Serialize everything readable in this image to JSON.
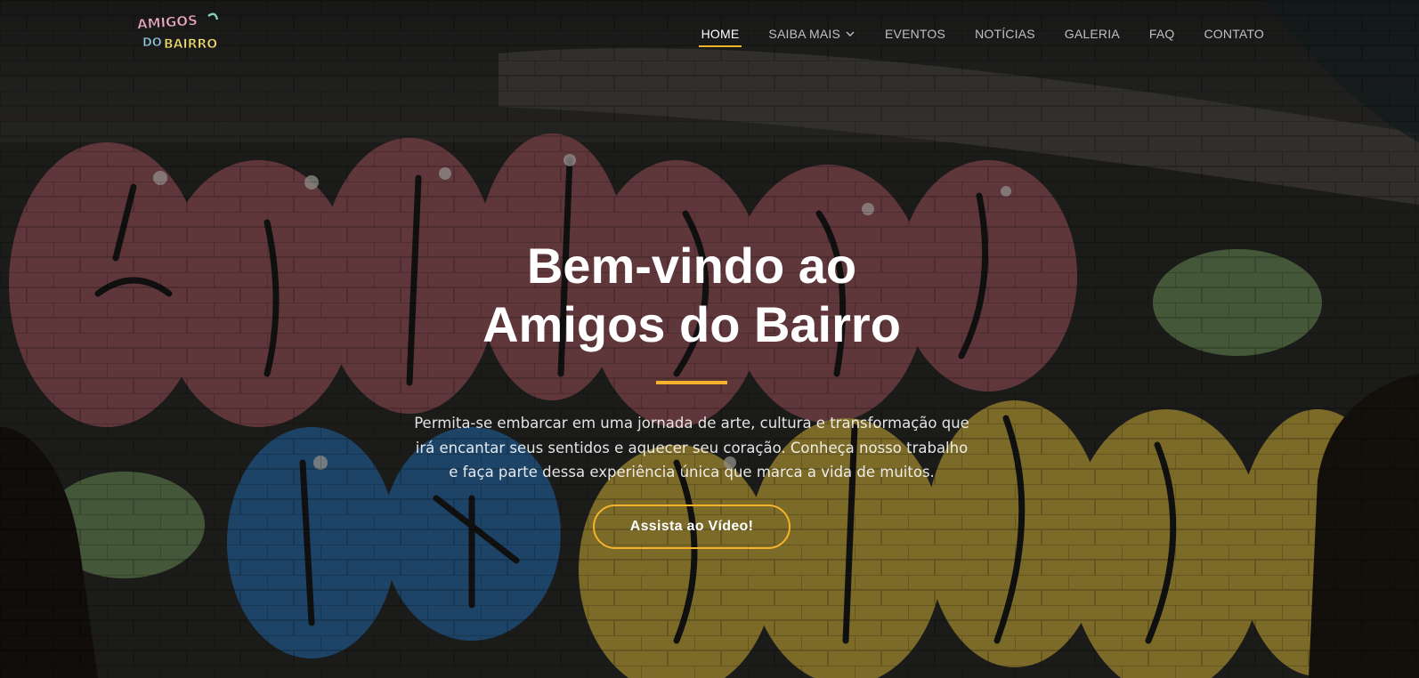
{
  "colors": {
    "accent": "#f5b32b",
    "nav_text": "#d8d8d8",
    "nav_active": "#ffffff"
  },
  "header": {
    "logo_text": [
      "AMIGOS",
      "DO",
      "BAIRRO"
    ],
    "nav": {
      "items": [
        {
          "label": "HOME",
          "active": true
        },
        {
          "label": "SAIBA MAIS",
          "has_dropdown": true
        },
        {
          "label": "EVENTOS"
        },
        {
          "label": "NOTÍCIAS"
        },
        {
          "label": "GALERIA"
        },
        {
          "label": "FAQ"
        },
        {
          "label": "CONTATO"
        }
      ]
    }
  },
  "hero": {
    "title_line1": "Bem-vindo ao",
    "title_line2": "Amigos do Bairro",
    "text": "Permita-se embarcar em uma jornada de arte, cultura e transformação que irá encantar seus sentidos e aquecer seu coração. Conheça nosso trabalho e faça parte dessa experiência única que marca a vida de muitos.",
    "button_label": "Assista ao Vídeo!",
    "background": "graffiti-wall-amigos-do-bairro"
  }
}
